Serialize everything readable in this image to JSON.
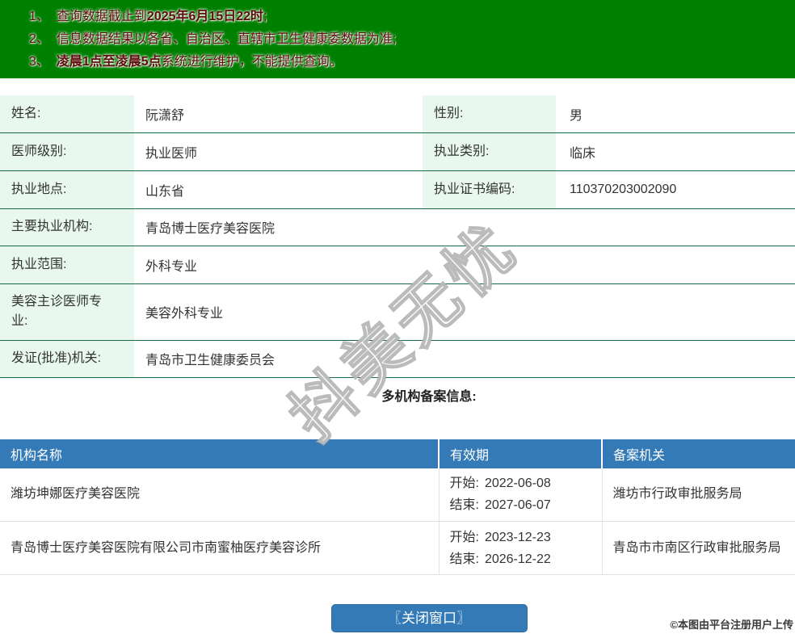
{
  "notices": [
    {
      "num": "1、",
      "pre": "查询数据截止到",
      "bold": "2025年6月15日22时",
      "post": ";"
    },
    {
      "num": "2、",
      "pre": "信息数据结果以各省、自治区、直辖市卫生健康委数据为准;",
      "bold": "",
      "post": ""
    },
    {
      "num": "3、",
      "pre": "",
      "bold": "凌晨1点至凌晨5点",
      "post": "系统进行维护，不能提供查询。"
    }
  ],
  "info": {
    "rows_paired": [
      {
        "label1": "姓名:",
        "value1": "阮潇舒",
        "label2": "性别:",
        "value2": "男"
      },
      {
        "label1": "医师级别:",
        "value1": "执业医师",
        "label2": "执业类别:",
        "value2": "临床"
      },
      {
        "label1": "执业地点:",
        "value1": "山东省",
        "label2": "执业证书编码:",
        "value2": "110370203002090"
      }
    ],
    "rows_full": [
      {
        "label": "主要执业机构:",
        "value": "青岛博士医疗美容医院"
      },
      {
        "label": "执业范围:",
        "value": "外科专业"
      },
      {
        "label": "美容主诊医师专业:",
        "value": "美容外科专业"
      },
      {
        "label": "发证(批准)机关:",
        "value": "青岛市卫生健康委员会"
      }
    ]
  },
  "section_title": "多机构备案信息:",
  "record_table": {
    "headers": [
      "机构名称",
      "有效期",
      "备案机关"
    ],
    "start_label": "开始:",
    "end_label": "结束:",
    "rows": [
      {
        "org": "潍坊坤娜医疗美容医院",
        "start": "2022-06-08",
        "end": "2027-06-07",
        "authority": "潍坊市行政审批服务局"
      },
      {
        "org": "青岛博士医疗美容医院有限公司市南蜜柚医疗美容诊所",
        "start": "2023-12-23",
        "end": "2026-12-22",
        "authority": "青岛市市南区行政审批服务局"
      }
    ]
  },
  "close_button_label": "〖关闭窗口〗",
  "watermark_text": "抖美无忧",
  "credit_text": "©本图由平台注册用户上传",
  "colors": {
    "banner_green": "#008000",
    "notice_text": "#5e0d0d",
    "label_cell_bg": "#e8f8ef",
    "row_border_green": "#156b43",
    "table_header_blue": "#337ab7",
    "button_blue": "#337ab7"
  }
}
